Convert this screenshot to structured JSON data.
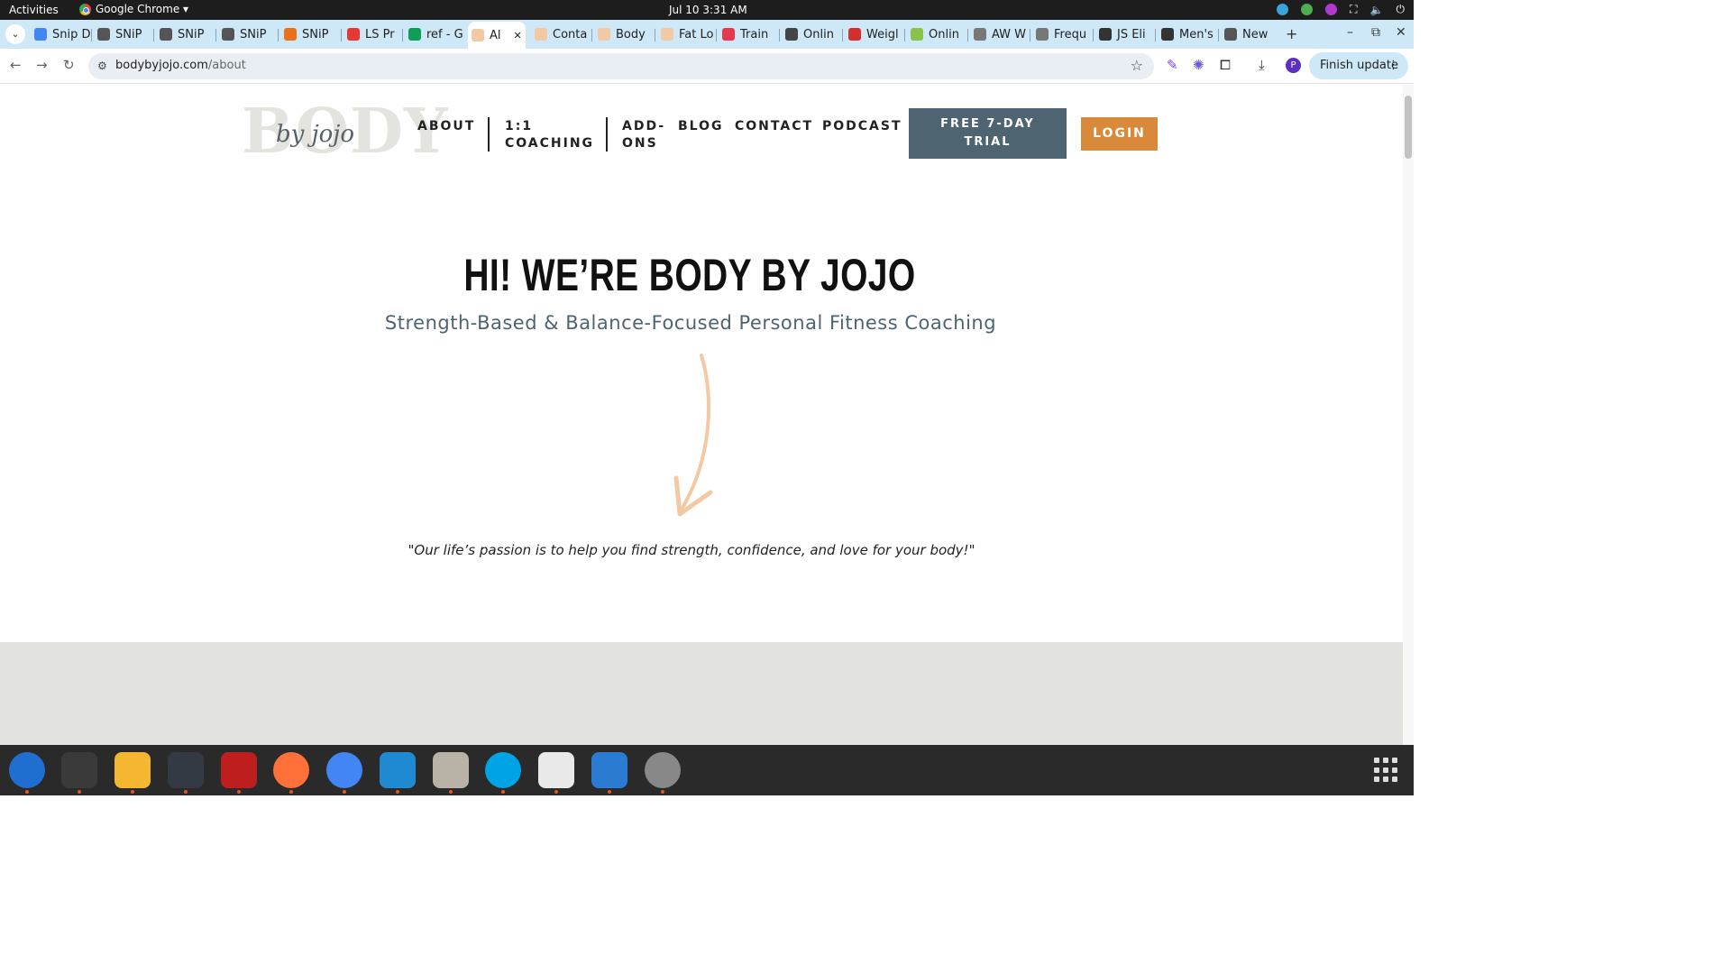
{
  "topbar": {
    "activities": "Activities",
    "app_name": "Google Chrome ▾",
    "clock": "Jul 10  3:31 AM"
  },
  "tabs": [
    {
      "label": "Snip D",
      "color": "#4285f4"
    },
    {
      "label": "SNiP",
      "color": "#555555"
    },
    {
      "label": "SNiP",
      "color": "#555555"
    },
    {
      "label": "SNiP",
      "color": "#555555"
    },
    {
      "label": "SNiP",
      "color": "#e8711a"
    },
    {
      "label": "LS Pr",
      "color": "#e53935"
    },
    {
      "label": "ref - G",
      "color": "#0f9d58"
    },
    {
      "label": "Al",
      "color": "#f1c9a5"
    },
    {
      "label": "Conta",
      "color": "#f1c9a5"
    },
    {
      "label": "Body",
      "color": "#f1c9a5"
    },
    {
      "label": "Fat Lo",
      "color": "#f1c9a5"
    },
    {
      "label": "Train",
      "color": "#e53950"
    },
    {
      "label": "Onlin",
      "color": "#444444"
    },
    {
      "label": "Weigl",
      "color": "#d32f2f"
    },
    {
      "label": "Onlin",
      "color": "#8bc34a"
    },
    {
      "label": "AW W",
      "color": "#777777"
    },
    {
      "label": "Frequ",
      "color": "#777777"
    },
    {
      "label": "JS Eli",
      "color": "#333333"
    },
    {
      "label": "Men's",
      "color": "#333333"
    },
    {
      "label": "New",
      "color": "#555555"
    }
  ],
  "tab_close": "✕",
  "new_tab": "+",
  "address": {
    "host": "bodybyjojo.com",
    "path": "/about"
  },
  "finish_update": "Finish update",
  "site": {
    "logo_big": "BODY",
    "logo_script": "by jojo",
    "nav": {
      "about": "ABOUT",
      "coaching_1": "1:1",
      "coaching_2": "COACHING",
      "addons_1": "ADD-",
      "addons_2": "ONS",
      "blog": "BLOG",
      "contact": "CONTACT",
      "podcast": "PODCAST"
    },
    "trial_1": "FREE 7-DAY",
    "trial_2": "TRIAL",
    "login": "LOGIN",
    "headline": "HI! WE’RE BODY BY JOJO",
    "subhead": "Strength-Based & Balance-Focused Personal Fitness Coaching",
    "quote": "\"Our life’s passion is to help you find strength, confidence, and love for your body!\""
  },
  "colors": {
    "accent_slate": "#4e6470",
    "accent_orange": "#d9893a",
    "arrow": "#f3c9a4",
    "band": "#e2e3de"
  },
  "dock": [
    {
      "name": "thunderbird",
      "color": "#1f6fd1"
    },
    {
      "name": "terminal",
      "color": "#3a3a3a"
    },
    {
      "name": "calculator",
      "color": "#f5b731"
    },
    {
      "name": "system-monitor",
      "color": "#333a44"
    },
    {
      "name": "filezilla",
      "color": "#bf1e1e"
    },
    {
      "name": "firefox",
      "color": "#ff7139"
    },
    {
      "name": "chrome",
      "color": "#4285f4"
    },
    {
      "name": "vscode",
      "color": "#1f8ad2"
    },
    {
      "name": "files",
      "color": "#b9b3a7"
    },
    {
      "name": "skype",
      "color": "#00a3e6"
    },
    {
      "name": "text-editor",
      "color": "#e9e9e9"
    },
    {
      "name": "libreoffice-writer",
      "color": "#2a7bd1"
    },
    {
      "name": "disk-utility",
      "color": "#888888"
    }
  ]
}
